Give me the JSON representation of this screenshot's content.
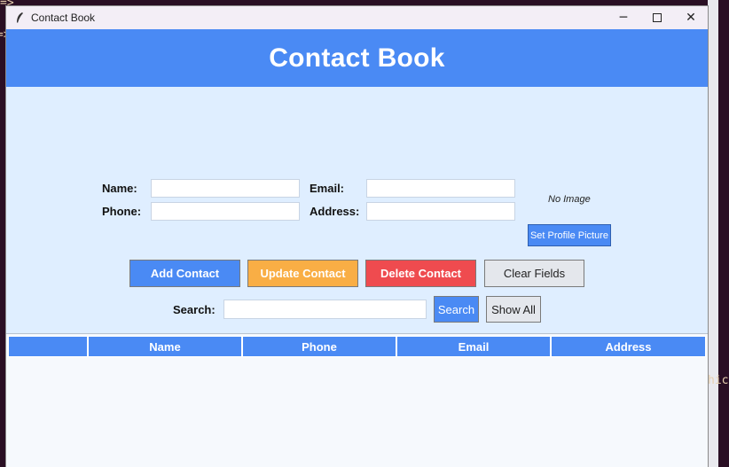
{
  "background": {
    "prompt_fragment_top": "=>",
    "prompt_fragment_left": "=>",
    "terminal_fragment_right": "hic"
  },
  "window": {
    "title": "Contact Book",
    "icon": "feather-icon",
    "controls": {
      "minimize": "─",
      "maximize": "☐",
      "close": "✕"
    }
  },
  "header": {
    "title": "Contact Book"
  },
  "form": {
    "name_label": "Name:",
    "email_label": "Email:",
    "phone_label": "Phone:",
    "address_label": "Address:",
    "name_value": "",
    "email_value": "",
    "phone_value": "",
    "address_value": "",
    "no_image_text": "No Image",
    "set_picture_label": "Set Profile Picture"
  },
  "actions": {
    "add": "Add Contact",
    "update": "Update Contact",
    "delete": "Delete Contact",
    "clear": "Clear Fields"
  },
  "search": {
    "label": "Search:",
    "value": "",
    "button": "Search",
    "show_all": "Show All"
  },
  "table": {
    "columns": [
      "",
      "Name",
      "Phone",
      "Email",
      "Address"
    ],
    "rows": []
  },
  "colors": {
    "accent": "#4a8af4",
    "update": "#f9ae45",
    "delete": "#ef4b4f",
    "panel": "#dfeeff"
  }
}
